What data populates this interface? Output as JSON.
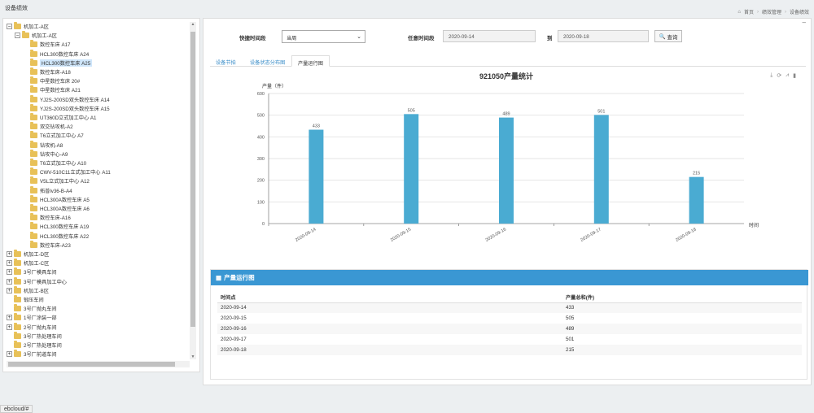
{
  "page_title": "设备绩效",
  "breadcrumb": {
    "home": "首页",
    "level1": "绩效管理",
    "level2": "设备绩效"
  },
  "tree": [
    {
      "label": "机加工-A区",
      "level": 0,
      "toggle": "−"
    },
    {
      "label": "机加工-A区",
      "level": 1,
      "toggle": "−"
    },
    {
      "label": "数控车床 A17",
      "level": 2
    },
    {
      "label": "HCL300数控车床 A24",
      "level": 2
    },
    {
      "label": "HCL300数控车床 A25",
      "level": 2,
      "selected": true
    },
    {
      "label": "数控车床-A18",
      "level": 2
    },
    {
      "label": "中星数控车床 20#",
      "level": 2
    },
    {
      "label": "中星数控车床 A21",
      "level": 2
    },
    {
      "label": "YJ2S-200SD双头数控车床 A14",
      "level": 2
    },
    {
      "label": "YJ2S-200SD双头数控车床 A15",
      "level": 2
    },
    {
      "label": "UT360D立式加工中心 A1",
      "level": 2
    },
    {
      "label": "双交钻攻机-A2",
      "level": 2
    },
    {
      "label": "T6立式加工中心 A7",
      "level": 2
    },
    {
      "label": "钻攻机-A8",
      "level": 2
    },
    {
      "label": "钻攻中心-A9",
      "level": 2
    },
    {
      "label": "T6立式加工中心 A10",
      "level": 2
    },
    {
      "label": "CWV-510C11立式加工中心 A11",
      "level": 2
    },
    {
      "label": "V5L立式加工中心 A12",
      "level": 2
    },
    {
      "label": "拓普lv36-B-A4",
      "level": 2
    },
    {
      "label": "HCL300A数控车床 A5",
      "level": 2
    },
    {
      "label": "HCL300A数控车床 A6",
      "level": 2
    },
    {
      "label": "数控车床-A16",
      "level": 2
    },
    {
      "label": "HCL300数控车床 A19",
      "level": 2
    },
    {
      "label": "HCL300数控车床 A22",
      "level": 2
    },
    {
      "label": "数控车床-A23",
      "level": 2
    },
    {
      "label": "机加工-D区",
      "level": 0,
      "toggle": "+"
    },
    {
      "label": "机加工-C区",
      "level": 0,
      "toggle": "+"
    },
    {
      "label": "3号厂模具车间",
      "level": 0,
      "toggle": "+"
    },
    {
      "label": "3号厂模具加工中心",
      "level": 0,
      "toggle": "+"
    },
    {
      "label": "机加工-B区",
      "level": 0,
      "toggle": "+"
    },
    {
      "label": "锻压车间",
      "level": 0
    },
    {
      "label": "3号厂抛丸车间",
      "level": 0
    },
    {
      "label": "1号厂涂装一部",
      "level": 0,
      "toggle": "+"
    },
    {
      "label": "2号厂抛丸车间",
      "level": 0,
      "toggle": "+"
    },
    {
      "label": "3号厂热处理车间",
      "level": 0
    },
    {
      "label": "2号厂热处理车间",
      "level": 0
    },
    {
      "label": "3号厂前道车间",
      "level": 0,
      "toggle": "+"
    }
  ],
  "filters": {
    "quick_label": "快捷时间段",
    "quick_value": "当周",
    "range_label": "任意时间段",
    "start": "2020-09-14",
    "to_label": "到",
    "end": "2020-09-18",
    "query_button": "查询"
  },
  "tabs": [
    "设备节拍",
    "设备状态分布图",
    "产量运行图"
  ],
  "toolbox_icons": [
    "download-icon",
    "refresh-icon",
    "line-chart-icon",
    "bar-chart-icon"
  ],
  "chart_data": {
    "type": "bar",
    "title": "921050产量统计",
    "ylabel": "产量（件）",
    "xlabel": "时间",
    "categories": [
      "2020-09-14",
      "2020-09-15",
      "2020-09-16",
      "2020-09-17",
      "2020-09-18"
    ],
    "values": [
      433,
      505,
      489,
      501,
      215
    ],
    "yticks": [
      0,
      100,
      200,
      300,
      400,
      500,
      600
    ],
    "ylim": [
      0,
      600
    ],
    "grid": true,
    "bar_color": "#4aabd2"
  },
  "panel": {
    "title": "产量运行图",
    "columns": [
      "时间点",
      "产量总和(件)"
    ],
    "rows": [
      [
        "2020-09-14",
        "433"
      ],
      [
        "2020-09-15",
        "505"
      ],
      [
        "2020-09-16",
        "489"
      ],
      [
        "2020-09-17",
        "501"
      ],
      [
        "2020-09-18",
        "215"
      ]
    ]
  },
  "status_bar": "ebcloud/#"
}
